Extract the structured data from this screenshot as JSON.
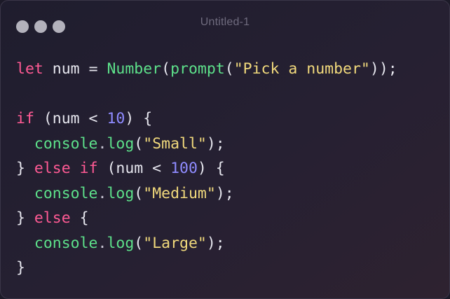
{
  "window": {
    "title": "Untitled-1"
  },
  "colors": {
    "keyword": "#ff5a94",
    "function": "#5de08a",
    "string": "#f1d97c",
    "number": "#8f8bff",
    "text": "#e6e6ee"
  },
  "code": {
    "l1": {
      "kw_let": "let",
      "t1": " num = ",
      "fn_number": "Number",
      "p1": "(",
      "fn_prompt": "prompt",
      "p2": "(",
      "str": "\"Pick a number\"",
      "p3": "));"
    },
    "l3": {
      "kw_if": "if",
      "t1": " (num < ",
      "num": "10",
      "t2": ") {"
    },
    "l4": {
      "indent": "  ",
      "fn_console": "console",
      "dot": ".",
      "fn_log": "log",
      "p1": "(",
      "str": "\"Small\"",
      "p2": ");"
    },
    "l5": {
      "t1": "} ",
      "kw_else": "else",
      "sp": " ",
      "kw_if": "if",
      "t2": " (num < ",
      "num": "100",
      "t3": ") {"
    },
    "l6": {
      "indent": "  ",
      "fn_console": "console",
      "dot": ".",
      "fn_log": "log",
      "p1": "(",
      "str": "\"Medium\"",
      "p2": ");"
    },
    "l7": {
      "t1": "} ",
      "kw_else": "else",
      "t2": " {"
    },
    "l8": {
      "indent": "  ",
      "fn_console": "console",
      "dot": ".",
      "fn_log": "log",
      "p1": "(",
      "str": "\"Large\"",
      "p2": ");"
    },
    "l9": {
      "t1": "}"
    }
  }
}
